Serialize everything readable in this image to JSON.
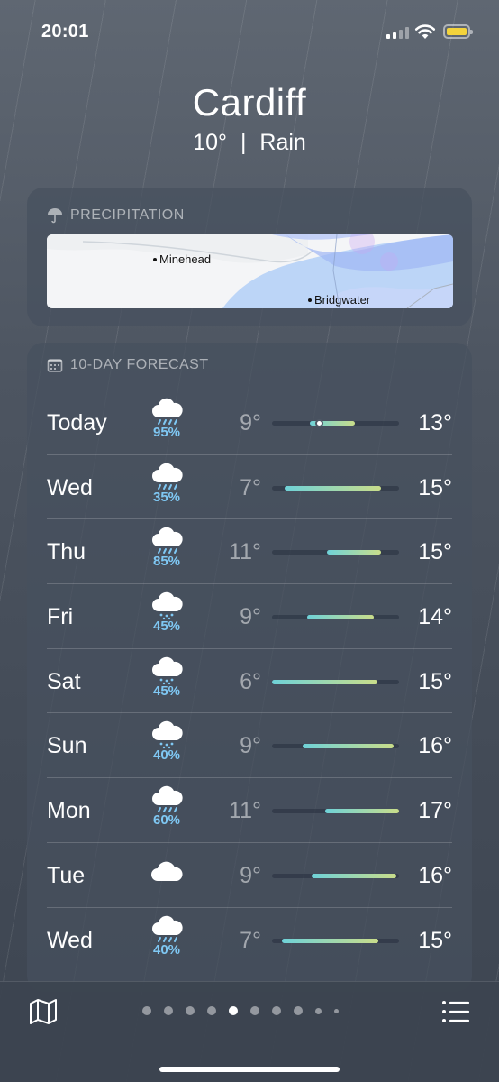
{
  "status": {
    "time": "20:01",
    "battery_color": "#f3d33c"
  },
  "location": {
    "city": "Cardiff",
    "temperature": "10°",
    "separator": "|",
    "condition": "Rain"
  },
  "precipitation": {
    "title": "PRECIPITATION",
    "places": [
      "Minehead",
      "Bridgwater"
    ]
  },
  "forecast": {
    "title": "10-DAY FORECAST",
    "days": [
      {
        "day": "Today",
        "icon": "rain-cloud-icon",
        "chance": "95%",
        "low": "9°",
        "high": "13°",
        "range_start": 0.3,
        "range_end": 0.65,
        "current": 0.37
      },
      {
        "day": "Wed",
        "icon": "rain-cloud-icon",
        "chance": "35%",
        "low": "7°",
        "high": "15°",
        "range_start": 0.1,
        "range_end": 0.86
      },
      {
        "day": "Thu",
        "icon": "rain-cloud-icon",
        "chance": "85%",
        "low": "11°",
        "high": "15°",
        "range_start": 0.43,
        "range_end": 0.86
      },
      {
        "day": "Fri",
        "icon": "drizzle-cloud-icon",
        "chance": "45%",
        "low": "9°",
        "high": "14°",
        "range_start": 0.28,
        "range_end": 0.8
      },
      {
        "day": "Sat",
        "icon": "drizzle-cloud-icon",
        "chance": "45%",
        "low": "6°",
        "high": "15°",
        "range_start": 0.0,
        "range_end": 0.83
      },
      {
        "day": "Sun",
        "icon": "drizzle-cloud-icon",
        "chance": "40%",
        "low": "9°",
        "high": "16°",
        "range_start": 0.24,
        "range_end": 0.96
      },
      {
        "day": "Mon",
        "icon": "rain-cloud-icon",
        "chance": "60%",
        "low": "11°",
        "high": "17°",
        "range_start": 0.42,
        "range_end": 1.0
      },
      {
        "day": "Tue",
        "icon": "cloud-icon",
        "chance": "",
        "low": "9°",
        "high": "16°",
        "range_start": 0.31,
        "range_end": 0.98
      },
      {
        "day": "Wed",
        "icon": "rain-cloud-icon",
        "chance": "40%",
        "low": "7°",
        "high": "15°",
        "range_start": 0.08,
        "range_end": 0.84
      }
    ]
  },
  "pager": {
    "count": 10,
    "active": 4
  },
  "colors": {
    "bar_cool": "#6fd2d8",
    "bar_warm": "#c9dd8a",
    "chance": "#7fc8f4"
  }
}
